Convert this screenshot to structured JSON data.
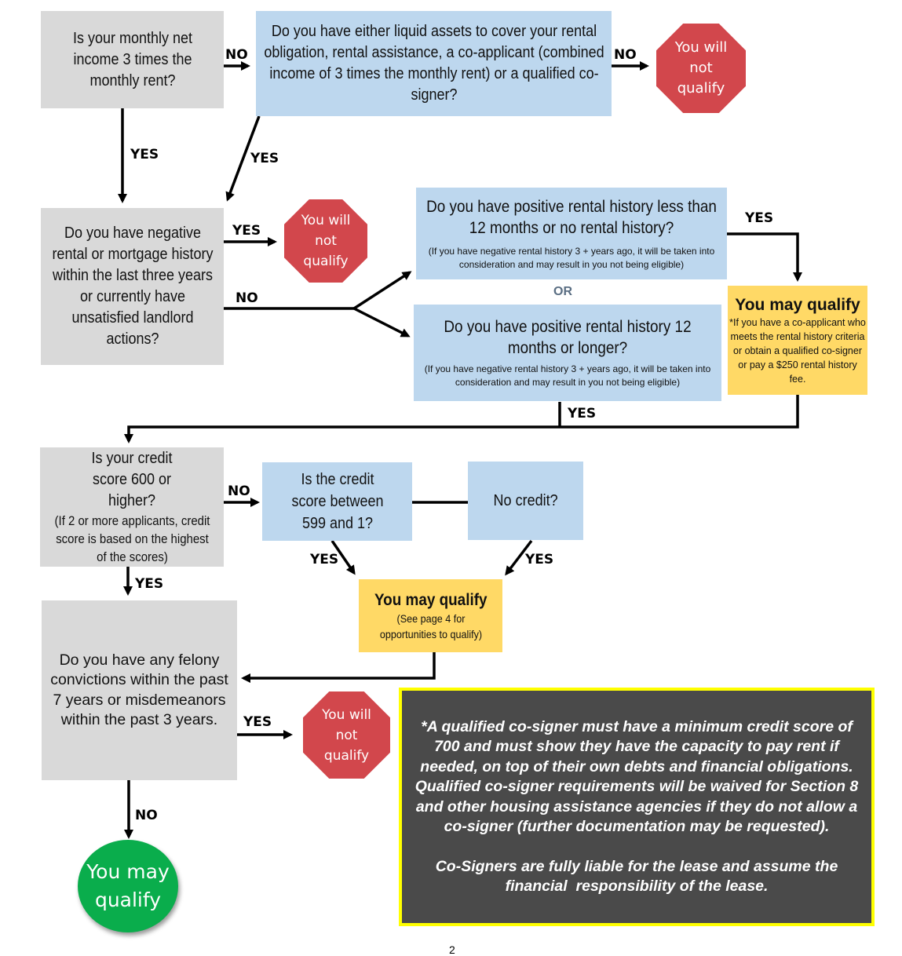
{
  "nodes": {
    "income_question": "Is your monthly net income 3 times the monthly rent?",
    "alternatives_question": "Do you have either liquid assets to cover your rental obligation, rental assistance, a co-applicant (combined income of 3 times the monthly rent) or a qualified co-signer?",
    "negative_history_question": "Do you have negative rental or mortgage history within the last three years or currently have unsatisfied landlord actions?",
    "short_history_question": "Do you have positive rental history less than 12 months or no rental history?",
    "short_history_note": "(If you have negative rental history 3 + years ago, it will be taken into consideration and may result in you not being eligible)",
    "or_label": "OR",
    "long_history_question": "Do you have positive rental history 12 months or longer?",
    "long_history_note": "(If you have negative rental history 3 + years ago, it will be taken into consideration and may result in you not being eligible)",
    "may_qualify_history_title": "You may qualify",
    "may_qualify_history_note": "*If you have a co-applicant who meets the rental history criteria or obtain a qualified co-signer or pay a $250 rental history fee.",
    "credit_question": "Is your credit score 600 or higher?",
    "credit_note": "(If 2 or more applicants, credit score is based on the highest of the scores)",
    "credit_range_question": "Is the credit score between 599 and 1?",
    "no_credit_question": "No credit?",
    "may_qualify_credit_title": "You may qualify",
    "may_qualify_credit_note": "(See page 4 for opportunities to qualify)",
    "criminal_question": "Do you have any felony convictions within the past 7 years or misdemeanors within the past 3 years.",
    "not_qualify_1": "You will not qualify",
    "not_qualify_2": "You will not qualify",
    "not_qualify_3": "You will not qualify",
    "final_may_qualify": "You may qualify"
  },
  "edge_labels": {
    "income_no": "NO",
    "income_yes": "YES",
    "alternatives_no": "NO",
    "alternatives_yes": "YES",
    "negative_yes": "YES",
    "negative_no": "NO",
    "short_history_yes": "YES",
    "long_history_yes": "YES",
    "credit_no": "NO",
    "credit_yes": "YES",
    "credit_range_yes": "YES",
    "no_credit_yes": "YES",
    "criminal_yes": "YES",
    "criminal_no": "NO"
  },
  "cosigner_note": {
    "paragraph1": "*A qualified co-signer must have a minimum credit score of 700 and must show they have the capacity to pay rent if needed, on top of their own debts and financial obligations. Qualified co-signer requirements will be waived for Section 8 and other housing assistance agencies if they do not allow a co-signer (further documentation may be requested).",
    "paragraph2": "Co-Signers are fully liable for the lease and assume the financial  responsibility of the lease."
  },
  "page_number": "2",
  "colors": {
    "question_gray": "#d9d9d9",
    "question_blue": "#bdd7ee",
    "may_qualify_yellow": "#ffd966",
    "stop_red": "#d2474c",
    "qualify_green": "#0aad4c",
    "note_background": "#4a4a4a",
    "note_border": "#ffff00"
  }
}
